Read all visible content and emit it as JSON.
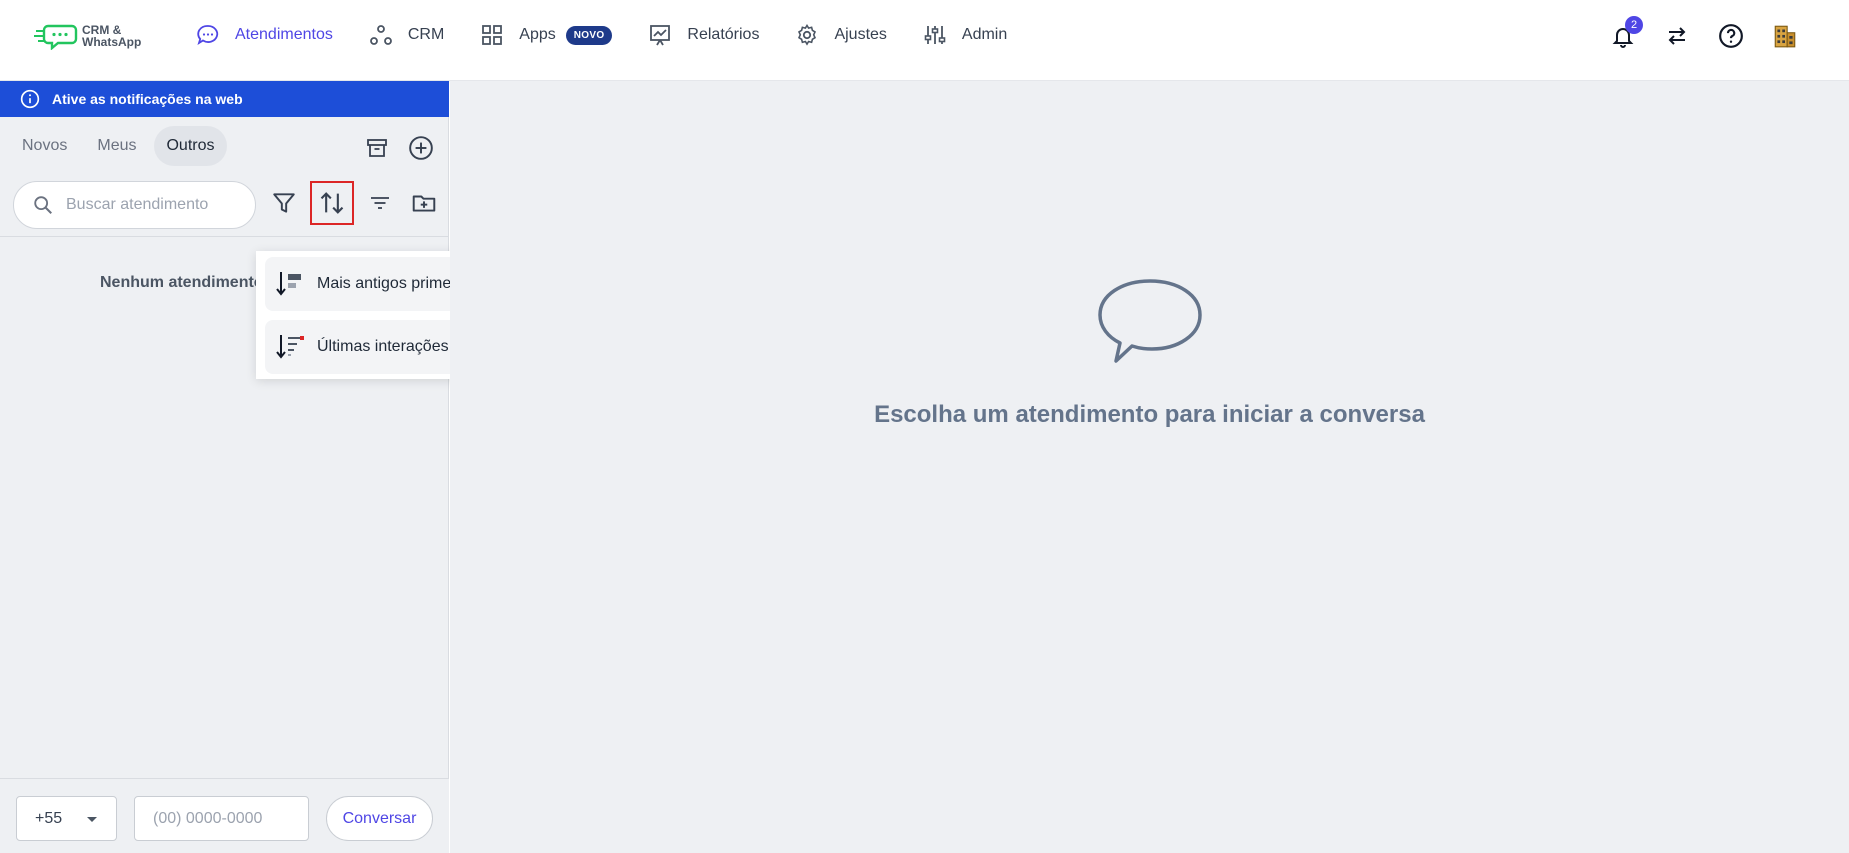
{
  "app": {
    "logo_line1": "CRM &",
    "logo_line2": "WhatsApp"
  },
  "nav": {
    "atendimentos": "Atendimentos",
    "crm": "CRM",
    "apps": "Apps",
    "apps_badge": "NOVO",
    "relatorios": "Relatórios",
    "ajustes": "Ajustes",
    "admin": "Admin"
  },
  "topright": {
    "notification_count": "2"
  },
  "notify_bar": {
    "text": "Ative as notificações na web"
  },
  "tabs": {
    "novos": "Novos",
    "meus": "Meus",
    "outros": "Outros",
    "active": "Outros"
  },
  "search": {
    "placeholder": "Buscar atendimento"
  },
  "list": {
    "empty_text": "Nenhum atendimento"
  },
  "sort_menu": {
    "options": [
      {
        "label": "Mais antigos primeiro",
        "selected": false
      },
      {
        "label": "Últimas interações primeiro",
        "selected": true
      }
    ]
  },
  "footer": {
    "country_code": "+55",
    "phone_placeholder": "(00) 0000-0000",
    "conversar_label": "Conversar"
  },
  "main": {
    "empty_title": "Escolha um atendimento para iniciar a conversa"
  },
  "colors": {
    "accent": "#4f46e5",
    "notify_bar": "#1d4ed8",
    "badge": "#1e3a8a",
    "highlight": "#dc2626",
    "panel_bg": "#eef0f3"
  }
}
